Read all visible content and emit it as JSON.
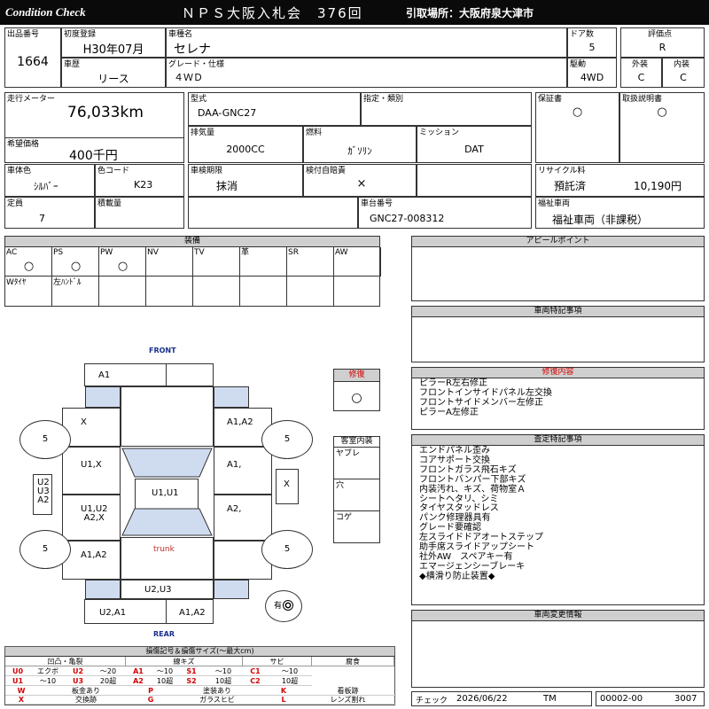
{
  "header": {
    "brand": "Condition  Check",
    "title": "ＮＰＳ大阪入札会　376回",
    "location": "引取場所：大阪府泉大津市"
  },
  "info": {
    "lot_label": "出品番号",
    "lot": "1664",
    "first_reg_label": "初度登録",
    "first_reg": "H30年07月",
    "history_label": "車歴",
    "history": "リース",
    "car_name_label": "車種名",
    "car_name": "セレナ",
    "grade_label": "グレード・仕様",
    "grade": "４ＷＤ",
    "doors_label": "ドア数",
    "doors": "5",
    "drive_label": "駆動",
    "drive": "4WD",
    "score_label": "評価点",
    "score": "R",
    "ext_label": "外装",
    "ext": "C",
    "int_label": "内装",
    "int": "C",
    "mileage_label": "走行メーター",
    "mileage": "76,033km",
    "price_label": "希望価格",
    "price": "400千円",
    "model_label": "型式",
    "model": "DAA-GNC27",
    "class_label": "指定・類別",
    "disp_label": "排気量",
    "disp": "2000CC",
    "fuel_label": "燃料",
    "fuel": "ｶﾞｿﾘﾝ",
    "mission_label": "ミッション",
    "mission": "DAT",
    "warranty_label": "保証書",
    "warranty": "○",
    "manual_label": "取扱説明書",
    "manual": "○",
    "color_label": "車体色",
    "color": "ｼﾙﾊﾞｰ",
    "color_code_label": "色コード",
    "color_code": "K23",
    "inspection_label": "車検期限",
    "inspection": "抹消",
    "insurance_label": "検付自賠責",
    "insurance": "×",
    "recycle_label": "リサイクル料",
    "recycle_status": "預託済",
    "recycle_fee": "10,190円",
    "capacity_label": "定員",
    "capacity": "7",
    "load_label": "積載量",
    "chassis_label": "車台番号",
    "chassis": "GNC27-008312",
    "welfare_label": "福祉車両",
    "welfare": "福祉車両（非課税）"
  },
  "equipment": {
    "title": "装備",
    "row1": [
      {
        "label": "AC",
        "mark": "○"
      },
      {
        "label": "PS",
        "mark": "○"
      },
      {
        "label": "PW",
        "mark": "○"
      },
      {
        "label": "NV",
        "mark": ""
      },
      {
        "label": "TV",
        "mark": ""
      },
      {
        "label": "革",
        "mark": ""
      },
      {
        "label": "SR",
        "mark": ""
      },
      {
        "label": "AW",
        "mark": ""
      }
    ],
    "row2": [
      "Wﾀｲﾔ",
      "左ﾊﾝﾄﾞﾙ",
      "",
      "",
      "",
      "",
      ""
    ]
  },
  "appeal": {
    "title": "アピールポイント"
  },
  "special": {
    "title": "車両特記事項"
  },
  "repair": {
    "title": "修復内容",
    "lines": [
      "ピラーR左右修正",
      "フロントインサイドパネル左交換",
      "フロントサイドメンバー左修正",
      "ピラーA左修正"
    ]
  },
  "assessment": {
    "title": "査定特記事項",
    "lines": [
      "エンドパネル歪み",
      "コアサポート交換",
      "フロントガラス飛石キズ",
      "フロントバンパー下部キズ",
      "内装汚れ、キズ、荷物室Ａ",
      "シートヘタリ、シミ",
      "タイヤスタッドレス",
      "パンク修理器具有",
      "グレード要確認",
      "左スライドドアオートステップ",
      "助手席スライドアップシート",
      "社外AW　スペアキー有",
      "エマージェンシーブレーキ",
      "◆横滑り防止装置◆"
    ]
  },
  "change": {
    "title": "車両変更情報"
  },
  "repair_box": {
    "title": "修復",
    "mark": "○"
  },
  "cabin": {
    "title": "客室内装",
    "items": [
      "ヤブレ",
      "穴",
      "コゲ"
    ]
  },
  "diagram": {
    "front": "FRONT",
    "rear": "REAR",
    "trunk": "trunk",
    "a1_top": "A1",
    "x_fl": "X",
    "a1a2_fr": "A1,A2",
    "u1x": "U1,X",
    "a1_r": "A1,",
    "u1u1": "U1,U1",
    "x_side": "X",
    "u2u3a2": "U2\nU3\nA2",
    "u1u2": "U1,U2\nA2,X",
    "a2_r": "A2,",
    "a1a2_rl": "A1,A2",
    "u2u3": "U2,U3",
    "u2a1": "U2,A1",
    "a1a2_b": "A1,A2",
    "tire": "5",
    "spare": "有"
  },
  "legend": {
    "title": "損傷記号＆損傷サイズ(～最大cm)",
    "groups": [
      "凹凸・亀裂",
      "線キズ",
      "サビ",
      "腐食"
    ],
    "codes": [
      [
        "U0",
        "エクボ",
        "U2",
        "～20",
        "A1",
        "～10",
        "S1",
        "～10",
        "C1",
        "～10"
      ],
      [
        "U1",
        "～10",
        "U3",
        "20超",
        "A2",
        "10超",
        "S2",
        "10超",
        "C2",
        "10超"
      ]
    ],
    "marks": [
      [
        "W",
        "板金あり",
        "P",
        "塗装あり",
        "K",
        "看板跡"
      ],
      [
        "X",
        "交換跡",
        "G",
        "ガラスヒビ",
        "L",
        "レンズ割れ"
      ]
    ]
  },
  "footer": {
    "check_label": "チェック",
    "date": "2026/06/22",
    "inspector": "TM",
    "code": "00002-00",
    "num": "3007"
  }
}
